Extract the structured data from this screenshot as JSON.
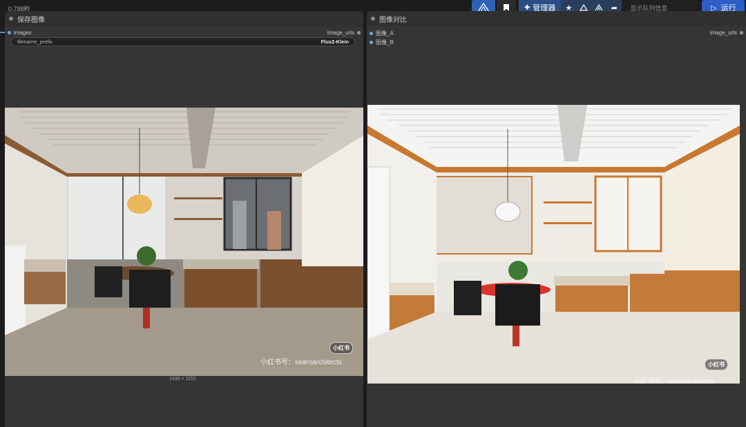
{
  "timing": "0.788秒",
  "toolbar": {
    "manager_label": "管理器",
    "queue_text": "显示队列信息",
    "run_label": "运行",
    "icons": [
      "logo-icon",
      "bookmark-icon",
      "puzzle-icon",
      "star-icon",
      "mountain-icon",
      "mountain-alt-icon",
      "share-icon",
      "play-icon"
    ]
  },
  "save_node": {
    "title": "保存图像",
    "input_label": "images",
    "output_label": "image_urls",
    "widget_name": "filename_prefix",
    "widget_value": "Flux2-Klein",
    "image_size": "1536 × 1152",
    "watermark": "小红书号：searoarchitects",
    "badge": "小红书"
  },
  "compare_node": {
    "title": "图像对比",
    "input_a": "图像_A",
    "input_b": "图像_B",
    "output_label": "image_urls",
    "watermark": "小红书号：searoarchitects",
    "badge": "小红书"
  },
  "colors": {
    "accent": "#2c5ec8",
    "node_bg": "#353535",
    "canvas_bg": "#1c1c1c",
    "slot": "#6aa8e8"
  }
}
